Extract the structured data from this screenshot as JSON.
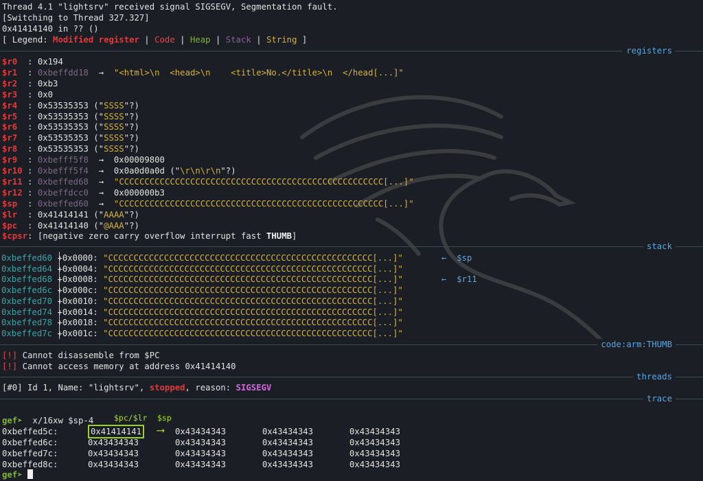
{
  "header": {
    "line1": "Thread 4.1 \"lightsrv\" received signal SIGSEGV, Segmentation fault.",
    "line2": "[Switching to Thread 327.327]",
    "line3": "0x41414140 in ?? ()",
    "legend_prefix": "[ Legend: ",
    "legend_modified": "Modified register",
    "legend_code": "Code",
    "legend_heap": "Heap",
    "legend_stack": "Stack",
    "legend_string": "String",
    "legend_sep": " | ",
    "legend_suffix": " ]"
  },
  "sections": {
    "registers": "registers",
    "stack": "stack",
    "code": "code:arm:THUMB",
    "threads": "threads",
    "trace": "trace"
  },
  "registers": [
    {
      "name": "$r0  ",
      "sep": ": ",
      "addr": "",
      "rest": "0x194",
      "str": "",
      "tail": ""
    },
    {
      "name": "$r1  ",
      "sep": ": ",
      "addr": "0xbeffdd18",
      "rest": "  →  ",
      "str": "\"<html>\\n  <head>\\n    <title>No.</title>\\n  </head[...]\"",
      "tail": ""
    },
    {
      "name": "$r2  ",
      "sep": ": ",
      "addr": "",
      "rest": "0xb3",
      "str": "",
      "tail": ""
    },
    {
      "name": "$r3  ",
      "sep": ": ",
      "addr": "",
      "rest": "0x0",
      "str": "",
      "tail": ""
    },
    {
      "name": "$r4  ",
      "sep": ": ",
      "addr": "",
      "rest": "0x53535353 (\"",
      "str": "SSSS",
      "tail": "\"?)"
    },
    {
      "name": "$r5  ",
      "sep": ": ",
      "addr": "",
      "rest": "0x53535353 (\"",
      "str": "SSSS",
      "tail": "\"?)"
    },
    {
      "name": "$r6  ",
      "sep": ": ",
      "addr": "",
      "rest": "0x53535353 (\"",
      "str": "SSSS",
      "tail": "\"?)"
    },
    {
      "name": "$r7  ",
      "sep": ": ",
      "addr": "",
      "rest": "0x53535353 (\"",
      "str": "SSSS",
      "tail": "\"?)"
    },
    {
      "name": "$r8  ",
      "sep": ": ",
      "addr": "",
      "rest": "0x53535353 (\"",
      "str": "SSSS",
      "tail": "\"?)"
    },
    {
      "name": "$r9  ",
      "sep": ": ",
      "addr": "0xbefff5f8",
      "rest": "  →  0x00009800",
      "str": "",
      "tail": ""
    },
    {
      "name": "$r10 ",
      "sep": ": ",
      "addr": "0xbefff5f4",
      "rest": "  →  0x0a0d0a0d (\"",
      "str": "\\r\\n\\r\\n",
      "tail": "\"?)"
    },
    {
      "name": "$r11 ",
      "sep": ": ",
      "addr": "0xbeffed68",
      "rest": "  →  ",
      "str": "\"CCCCCCCCCCCCCCCCCCCCCCCCCCCCCCCCCCCCCCCCCCCCCCCCCCCC[...]\"",
      "tail": ""
    },
    {
      "name": "$r12 ",
      "sep": ": ",
      "addr": "0xbeffdcc0",
      "rest": "  →  0x000000b3",
      "str": "",
      "tail": ""
    },
    {
      "name": "$sp  ",
      "sep": ": ",
      "addr": "0xbeffed60",
      "rest": "  →  ",
      "str": "\"CCCCCCCCCCCCCCCCCCCCCCCCCCCCCCCCCCCCCCCCCCCCCCCCCCCC[...]\"",
      "tail": ""
    },
    {
      "name": "$lr  ",
      "sep": ": ",
      "addr": "",
      "rest": "0x41414141 (\"",
      "str": "AAAA",
      "tail": "\"?)"
    },
    {
      "name": "$pc  ",
      "sep": ": ",
      "addr": "",
      "rest": "0x41414140 (\"",
      "str": "@AAA",
      "tail": "\"?)"
    }
  ],
  "cpsr": {
    "name": "$cpsr",
    "sep": ": ",
    "flags": "[negative zero carry overflow interrupt fast ",
    "thumb": "THUMB",
    "close": "]"
  },
  "stack": [
    {
      "addr": "0xbeffed60",
      "off": "+0x0000: ",
      "val": "\"CCCCCCCCCCCCCCCCCCCCCCCCCCCCCCCCCCCCCCCCCCCCCCCCCCCC[...]\"",
      "note": "←  $sp"
    },
    {
      "addr": "0xbeffed64",
      "off": "+0x0004: ",
      "val": "\"CCCCCCCCCCCCCCCCCCCCCCCCCCCCCCCCCCCCCCCCCCCCCCCCCCCC[...]\"",
      "note": ""
    },
    {
      "addr": "0xbeffed68",
      "off": "+0x0008: ",
      "val": "\"CCCCCCCCCCCCCCCCCCCCCCCCCCCCCCCCCCCCCCCCCCCCCCCCCCCC[...]\"",
      "note": "←  $r11"
    },
    {
      "addr": "0xbeffed6c",
      "off": "+0x000c: ",
      "val": "\"CCCCCCCCCCCCCCCCCCCCCCCCCCCCCCCCCCCCCCCCCCCCCCCCCCCC[...]\"",
      "note": ""
    },
    {
      "addr": "0xbeffed70",
      "off": "+0x0010: ",
      "val": "\"CCCCCCCCCCCCCCCCCCCCCCCCCCCCCCCCCCCCCCCCCCCCCCCCCCCC[...]\"",
      "note": ""
    },
    {
      "addr": "0xbeffed74",
      "off": "+0x0014: ",
      "val": "\"CCCCCCCCCCCCCCCCCCCCCCCCCCCCCCCCCCCCCCCCCCCCCCCCCCCC[...]\"",
      "note": ""
    },
    {
      "addr": "0xbeffed78",
      "off": "+0x0018: ",
      "val": "\"CCCCCCCCCCCCCCCCCCCCCCCCCCCCCCCCCCCCCCCCCCCCCCCCCCCC[...]\"",
      "note": ""
    },
    {
      "addr": "0xbeffed7c",
      "off": "+0x001c: ",
      "val": "\"CCCCCCCCCCCCCCCCCCCCCCCCCCCCCCCCCCCCCCCCCCCCCCCCCCCC[...]\"",
      "note": ""
    }
  ],
  "code": [
    {
      "tag": "[!]",
      "msg": " Cannot disassemble from $PC"
    },
    {
      "tag": "[!]",
      "msg": " Cannot access memory at address 0x41414140"
    }
  ],
  "threads": {
    "prefix": "[#0]",
    "mid": " Id 1, Name: \"lightsrv\", ",
    "state": "stopped",
    "mid2": ", reason: ",
    "reason": "SIGSEGV"
  },
  "prompt": {
    "label": "gef➤",
    "command": "  x/16xw $sp-4",
    "annot_pc": "$pc/$lr",
    "annot_sp": "$sp",
    "arrow": "⟶"
  },
  "memdump": [
    {
      "addr": "0xbeffed5c:",
      "w": [
        "0x41414141",
        "0x43434343",
        "0x43434343",
        "0x43434343"
      ]
    },
    {
      "addr": "0xbeffed6c:",
      "w": [
        "0x43434343",
        "0x43434343",
        "0x43434343",
        "0x43434343"
      ]
    },
    {
      "addr": "0xbeffed7c:",
      "w": [
        "0x43434343",
        "0x43434343",
        "0x43434343",
        "0x43434343"
      ]
    },
    {
      "addr": "0xbeffed8c:",
      "w": [
        "0x43434343",
        "0x43434343",
        "0x43434343",
        "0x43434343"
      ]
    }
  ],
  "colors": {
    "background": "#1b1e24",
    "modified": "#e23a3a",
    "code": "#e84747",
    "heap": "#7fb33a",
    "stack": "#8a5f9a",
    "string": "#d6b33e",
    "section": "#58a6e0",
    "annotation": "#a8e020"
  }
}
